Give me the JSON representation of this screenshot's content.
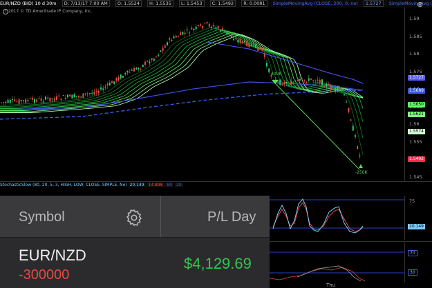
{
  "header": {
    "symbol": "EUR/NZD (BID) 10 d 30m",
    "date": "D: 7/13/17 7:00 AM",
    "open": "O: 1.5524",
    "high": "H: 1.5535",
    "low": "L: 1.5453",
    "close": "C: 1.5492",
    "range": "R: 0.0081",
    "sma1": "SimpleMovingAvg (CLOSE, 200, 0, no)",
    "sma1_val": "1.5727",
    "sma2": "SimpleMovingAvg (CLOSE,"
  },
  "copyright": "2017 © TD Ameritrade IP Company, Inc.",
  "price_axis": {
    "ticks": [
      "1.59",
      "1.585",
      "1.58",
      "1.575",
      "1.57",
      "1.565",
      "1.56",
      "1.555",
      "1.55",
      "1.545"
    ],
    "bubbles": [
      {
        "label": "1.5727",
        "color": "#5a5cff"
      },
      {
        "label": "1.5689",
        "color": "#3b5bdb"
      },
      {
        "label": "1.5650",
        "color": "#5dff5d"
      },
      {
        "label": "1.5621",
        "color": "#7fff7f"
      },
      {
        "label": "1.5574",
        "color": "#d8ffd8"
      },
      {
        "label": "1.5492",
        "color": "#ff2d4d"
      }
    ]
  },
  "annotations": {
    "high_label": "300K",
    "low_label": "-250K"
  },
  "stochastic": {
    "title": "StochasticSlow (80, 20, 5, 3, HIGH, LOW, CLOSE, SIMPLE, No)",
    "k": "20.149",
    "d": "14.898",
    "v3": "80",
    "v4": "20",
    "ticks": [
      "75",
      "20.149"
    ]
  },
  "lower_panel": {
    "ticks": [
      "70",
      "30"
    ],
    "xlabel": "Thu"
  },
  "card": {
    "symbol_header": "Symbol",
    "pl_header": "P/L Day",
    "symbol": "EUR/NZD",
    "quantity": "-300000",
    "pl_value": "$4,129.69"
  },
  "colors": {
    "up": "#2ecc71",
    "down": "#e74c3c",
    "card_bg": "#2b2b2d",
    "pl_green": "#34c44f",
    "qty_red": "#e84a3f"
  }
}
